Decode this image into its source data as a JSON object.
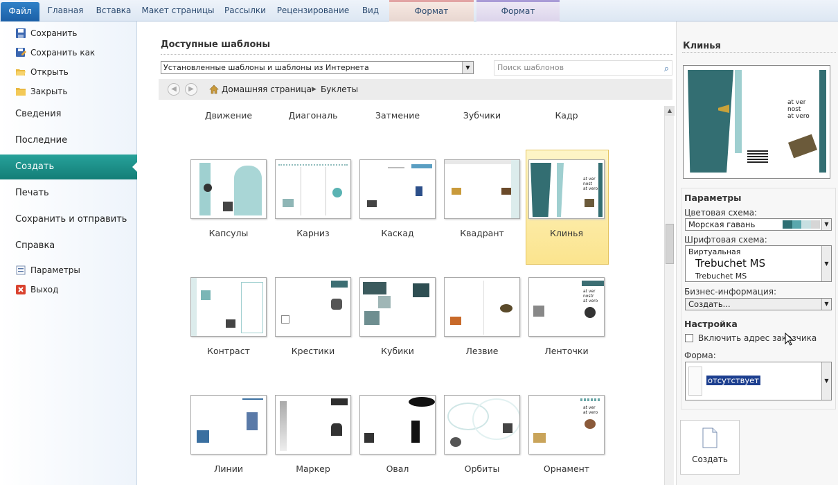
{
  "ribbon": {
    "tabs": [
      "Файл",
      "Главная",
      "Вставка",
      "Макет страницы",
      "Рассылки",
      "Рецензирование",
      "Вид",
      "Формат",
      "Формат"
    ]
  },
  "sidebar": {
    "top_items": [
      "Сохранить",
      "Сохранить как",
      "Открыть",
      "Закрыть"
    ],
    "sections": [
      "Сведения",
      "Последние",
      "Создать",
      "Печать",
      "Сохранить и отправить",
      "Справка"
    ],
    "active_section": "Создать",
    "bottom_items": [
      "Параметры",
      "Выход"
    ]
  },
  "main": {
    "heading": "Доступные шаблоны",
    "source_select": "Установленные шаблоны и шаблоны из Интернета",
    "search_placeholder": "Поиск шаблонов",
    "breadcrumb": {
      "home": "Домашняя страница",
      "current": "Буклеты"
    },
    "header_row": [
      "Движение",
      "Диагональ",
      "Затмение",
      "Зубчики",
      "Кадр"
    ],
    "templates": [
      [
        "Капсулы",
        "Карниз",
        "Каскад",
        "Квадрант",
        "Клинья"
      ],
      [
        "Контраст",
        "Крестики",
        "Кубики",
        "Лезвие",
        "Ленточки"
      ],
      [
        "Линии",
        "Маркер",
        "Овал",
        "Орбиты",
        "Орнамент"
      ]
    ],
    "selected_template": "Клинья"
  },
  "right": {
    "title": "Клинья",
    "preview_text": [
      "at ver",
      "nost",
      "at vero"
    ],
    "params_heading": "Параметры",
    "color_scheme_label": "Цветовая схема:",
    "color_scheme_value": "Морская гавань",
    "color_swatches": [
      "#2e6f73",
      "#5aa7ad",
      "#c7dfe1",
      "#d6d6d6"
    ],
    "font_scheme_label": "Шрифтовая схема:",
    "font_scheme_name": "Виртуальная",
    "font_scheme_heading": "Trebuchet MS",
    "font_scheme_body": "Trebuchet MS",
    "business_info_label": "Бизнес-информация:",
    "business_info_value": "Создать...",
    "custom_heading": "Настройка",
    "include_address_label": "Включить адрес заказчика",
    "form_label": "Форма:",
    "form_value": "отсутствует",
    "create_label": "Создать"
  },
  "colors": {
    "teal_accent": "#1d8b85",
    "selected_bg": "#fbe48e",
    "file_tab": "#2a78c0"
  }
}
